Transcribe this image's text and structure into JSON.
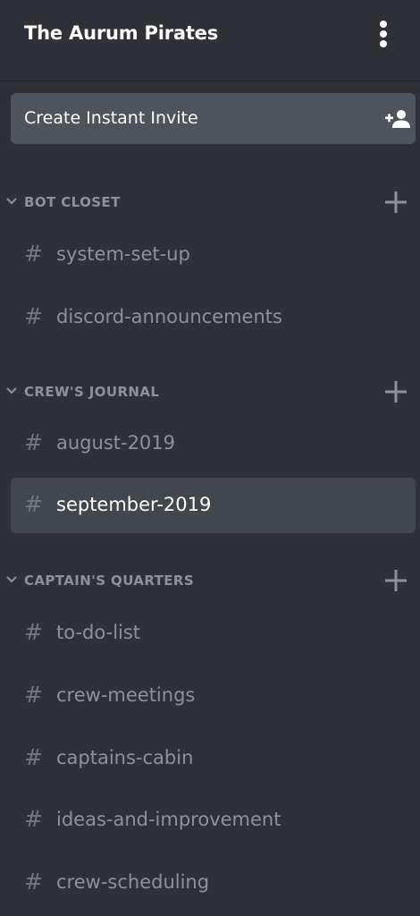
{
  "header": {
    "server_name": "The Aurum Pirates",
    "menu_icon": "kebab-menu-icon"
  },
  "invite": {
    "label": "Create Instant Invite",
    "icon": "add-user-icon"
  },
  "colors": {
    "background": "#2f3136",
    "invite_bg": "#4f545c",
    "active_bg": "#42464d",
    "text_muted": "#8e9297",
    "text_active": "#ffffff"
  },
  "categories": [
    {
      "label": "BOT CLOSET",
      "channels": [
        {
          "label": "system-set-up"
        },
        {
          "label": "discord-announcements"
        }
      ]
    },
    {
      "label": "CREW'S JOURNAL",
      "channels": [
        {
          "label": "august-2019"
        },
        {
          "label": "september-2019",
          "selected": true
        }
      ]
    },
    {
      "label": "CAPTAIN'S QUARTERS",
      "channels": [
        {
          "label": "to-do-list"
        },
        {
          "label": "crew-meetings"
        },
        {
          "label": "captains-cabin"
        },
        {
          "label": "ideas-and-improvement"
        },
        {
          "label": "crew-scheduling"
        }
      ]
    }
  ],
  "channel_prefix": "#"
}
